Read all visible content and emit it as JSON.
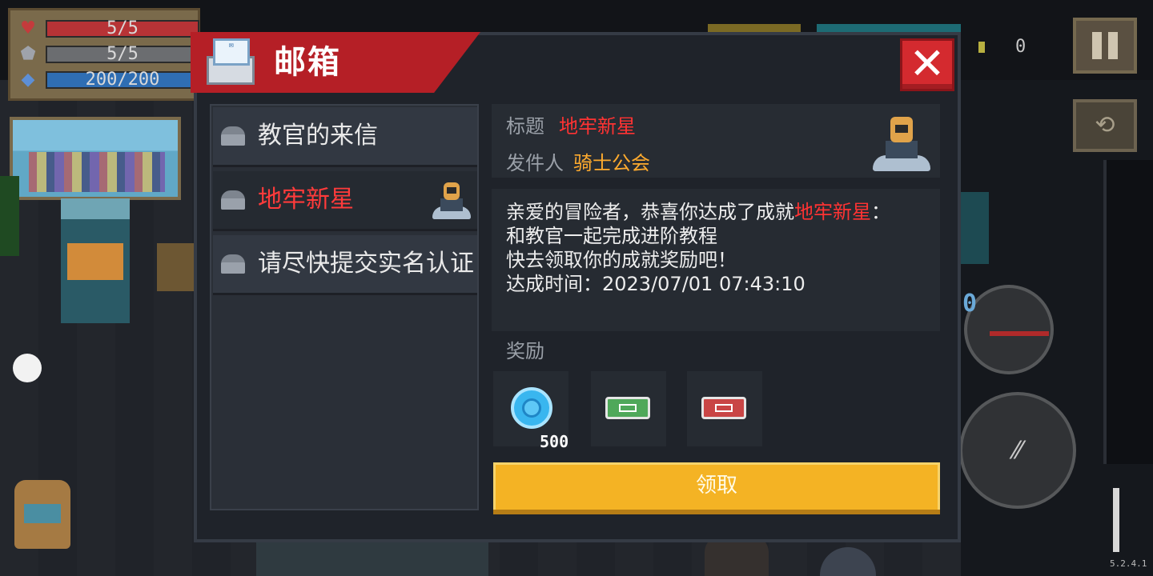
{
  "hud": {
    "health": "5/5",
    "armor": "5/5",
    "energy": "200/200",
    "gems": "0",
    "ammo": "0",
    "version": "5.2.4.1",
    "icons": {
      "health": "heart-icon",
      "armor": "shield-icon",
      "energy": "diamond-icon",
      "pause": "pause-icon",
      "swap": "swap-weapon-icon"
    }
  },
  "mailbox": {
    "title": "邮箱",
    "close_label": "✕",
    "mails": [
      {
        "label": "教官的来信",
        "active": false
      },
      {
        "label": "地牢新星",
        "active": true
      },
      {
        "label": "请尽快提交实名认证",
        "active": false
      }
    ],
    "detail": {
      "title_label": "标题",
      "title_value": "地牢新星",
      "sender_label": "发件人",
      "sender_value": "骑士公会"
    },
    "message": {
      "line1_prefix": "亲爱的冒险者，恭喜你达成了成就",
      "line1_highlight": "地牢新星",
      "line1_suffix": "：",
      "line2": "和教官一起完成进阶教程",
      "line3": "快去领取你的成就奖励吧！",
      "line4": "达成时间：2023/07/01 07:43:10"
    },
    "reward_label": "奖励",
    "rewards": [
      {
        "icon": "gem-coin-icon",
        "amount": "500"
      },
      {
        "icon": "green-ticket-icon",
        "amount": ""
      },
      {
        "icon": "red-ticket-icon",
        "amount": ""
      }
    ],
    "claim_label": "领取"
  },
  "colors": {
    "ribbon": "#b51f26",
    "highlight": "#ff3333",
    "sender": "#ffab2e",
    "claim_button": "#f4b324"
  }
}
